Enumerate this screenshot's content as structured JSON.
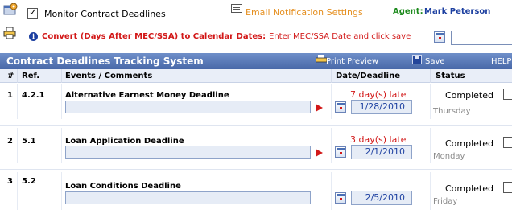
{
  "toolbar": {
    "monitor_label": "Monitor Contract Deadlines",
    "monitor_checked": true,
    "email_settings": "Email Notification Settings",
    "agent_label": "Agent:",
    "agent_name": "Mark Peterson"
  },
  "convert": {
    "title": "Convert (Days After MEC/SSA) to Calendar Dates:",
    "instruction": "Enter MEC/SSA Date and click save",
    "date_value": ""
  },
  "header": {
    "title": "Contract Deadlines Tracking System",
    "print_preview": "Print Preview",
    "save": "Save",
    "help": "HELP"
  },
  "columns": {
    "num": "#",
    "ref": "Ref.",
    "events": "Events / Comments",
    "date": "Date/Deadline",
    "status": "Status"
  },
  "rows": [
    {
      "num": "1",
      "ref": "4.2.1",
      "title": "Alternative Earnest Money Deadline",
      "comment": "",
      "late": "7 day(s) late",
      "date": "1/28/2010",
      "status": "Completed",
      "weekday": "Thursday",
      "flagged": true
    },
    {
      "num": "2",
      "ref": "5.1",
      "title": "Loan Application Deadline",
      "comment": "",
      "late": "3 day(s) late",
      "date": "2/1/2010",
      "status": "Completed",
      "weekday": "Monday",
      "flagged": true
    },
    {
      "num": "3",
      "ref": "5.2",
      "title": "Loan Conditions Deadline",
      "comment": "",
      "late": "",
      "date": "2/5/2010",
      "status": "Completed",
      "weekday": "Friday",
      "flagged": false
    }
  ],
  "colors": {
    "header_bg": "#5677b8",
    "late_red": "#d21818",
    "agent_green": "#1c8a1c",
    "link_orange": "#e58f1f",
    "date_blue": "#1c3fa0"
  }
}
